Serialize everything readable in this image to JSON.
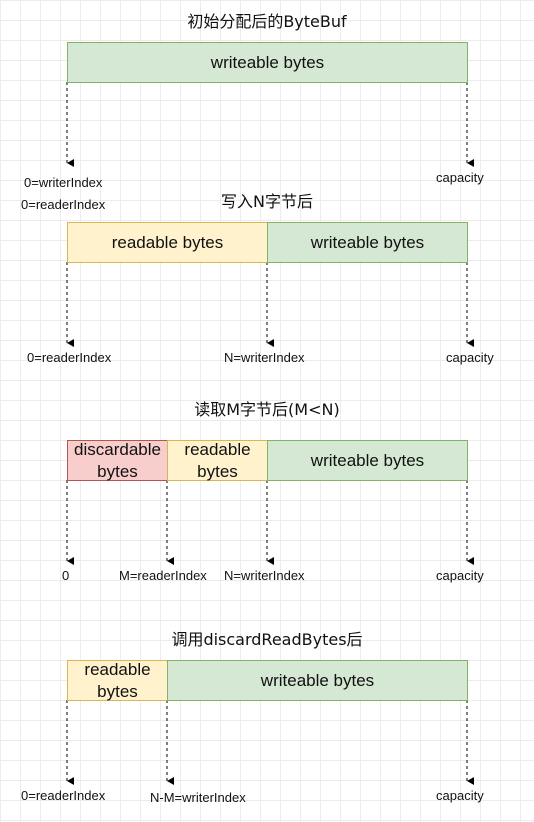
{
  "diagram1": {
    "title": "初始分配后的ByteBuf",
    "writeable": "writeable bytes",
    "writer_index": "0=writerIndex",
    "reader_index": "0=readerIndex",
    "capacity": "capacity"
  },
  "diagram2": {
    "title": "写入N字节后",
    "readable": "readable bytes",
    "writeable": "writeable bytes",
    "reader_index": "0=readerIndex",
    "writer_index": "N=writerIndex",
    "capacity": "capacity"
  },
  "diagram3": {
    "title": "读取M字节后(M<N)",
    "discardable_line1": "discardable",
    "discardable_line2": "bytes",
    "readable_line1": "readable",
    "readable_line2": "bytes",
    "writeable": "writeable bytes",
    "zero": "0",
    "reader_index": "M=readerIndex",
    "writer_index": "N=writerIndex",
    "capacity": "capacity"
  },
  "diagram4": {
    "title": "调用discardReadBytes后",
    "readable_line1": "readable",
    "readable_line2": "bytes",
    "writeable": "writeable bytes",
    "reader_index": "0=readerIndex",
    "writer_index": "N-M=writerIndex",
    "capacity": "capacity"
  },
  "colors": {
    "green_fill": "#d5e8d4",
    "green_stroke": "#82b366",
    "yellow_fill": "#fff2cc",
    "yellow_stroke": "#d6b656",
    "red_fill": "#f8cecc",
    "red_stroke": "#b85450"
  }
}
